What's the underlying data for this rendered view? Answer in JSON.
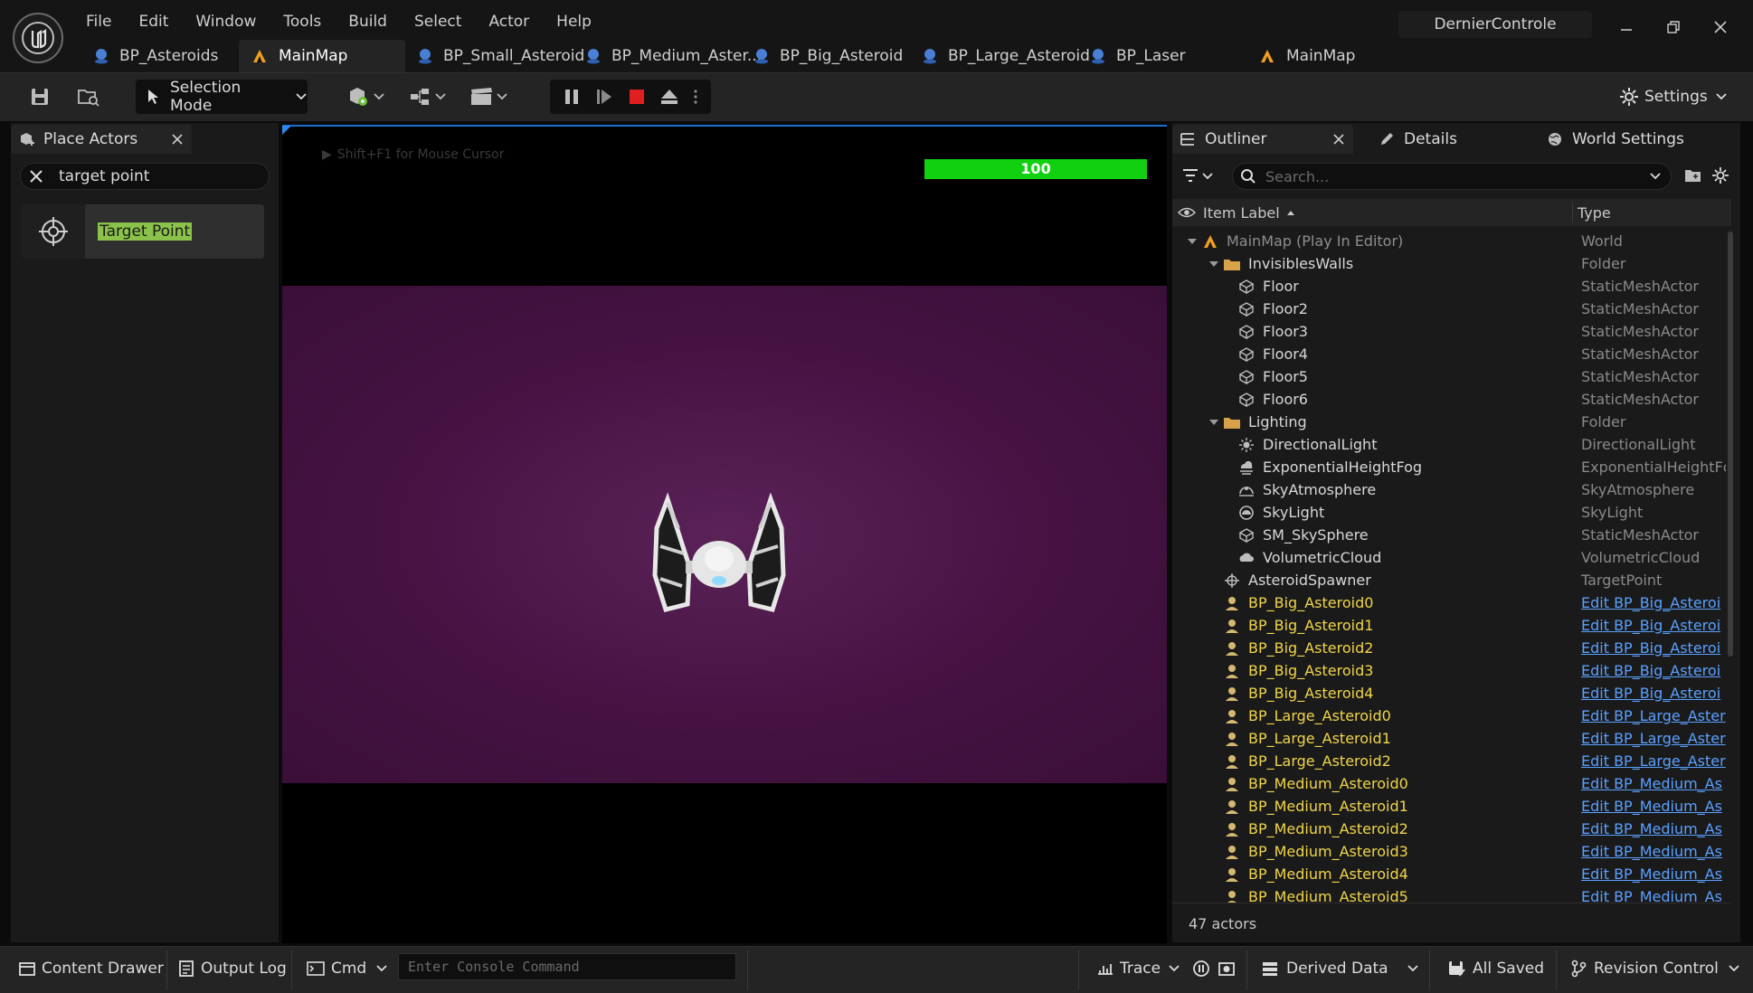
{
  "menu": [
    "File",
    "Edit",
    "Window",
    "Tools",
    "Build",
    "Select",
    "Actor",
    "Help"
  ],
  "project_name": "DernierControle",
  "doc_tabs": [
    {
      "label": "BP_Asteroids",
      "icon": "blueprint-icon"
    },
    {
      "label": "MainMap",
      "icon": "map-icon",
      "active": true
    },
    {
      "label": "BP_Small_Asteroid",
      "icon": "blueprint-icon"
    },
    {
      "label": "BP_Medium_Aster...",
      "icon": "blueprint-icon"
    },
    {
      "label": "BP_Big_Asteroid",
      "icon": "blueprint-icon"
    },
    {
      "label": "BP_Large_Asteroid",
      "icon": "blueprint-icon"
    },
    {
      "label": "BP_Laser",
      "icon": "blueprint-icon"
    },
    {
      "label": "MainMap",
      "icon": "map-icon"
    }
  ],
  "toolbar": {
    "selection_mode": "Selection Mode",
    "settings": "Settings"
  },
  "place_actors": {
    "tab_label": "Place Actors",
    "search_value": "target point",
    "result_label": "Target Point"
  },
  "viewport": {
    "hint": "Shift+F1 for Mouse Cursor",
    "health_value": "100"
  },
  "outliner": {
    "tab_outliner": "Outliner",
    "tab_details": "Details",
    "tab_world_settings": "World Settings",
    "search_placeholder": "Search...",
    "col_label": "Item Label",
    "col_type": "Type",
    "actor_count": "47 actors",
    "rows": [
      {
        "label": "MainMap (Play In Editor)",
        "type": "World",
        "indent": 0,
        "kind": "world",
        "icon": "map-icon"
      },
      {
        "label": "InvisiblesWalls",
        "type": "Folder",
        "indent": 1,
        "kind": "folder",
        "icon": "folder-icon"
      },
      {
        "label": "Floor",
        "type": "StaticMeshActor",
        "indent": 2,
        "kind": "item",
        "icon": "static-mesh-icon"
      },
      {
        "label": "Floor2",
        "type": "StaticMeshActor",
        "indent": 2,
        "kind": "item",
        "icon": "static-mesh-icon"
      },
      {
        "label": "Floor3",
        "type": "StaticMeshActor",
        "indent": 2,
        "kind": "item",
        "icon": "static-mesh-icon"
      },
      {
        "label": "Floor4",
        "type": "StaticMeshActor",
        "indent": 2,
        "kind": "item",
        "icon": "static-mesh-icon"
      },
      {
        "label": "Floor5",
        "type": "StaticMeshActor",
        "indent": 2,
        "kind": "item",
        "icon": "static-mesh-icon"
      },
      {
        "label": "Floor6",
        "type": "StaticMeshActor",
        "indent": 2,
        "kind": "item",
        "icon": "static-mesh-icon"
      },
      {
        "label": "Lighting",
        "type": "Folder",
        "indent": 1,
        "kind": "folder",
        "icon": "folder-icon"
      },
      {
        "label": "DirectionalLight",
        "type": "DirectionalLight",
        "indent": 2,
        "kind": "item",
        "icon": "sun-icon"
      },
      {
        "label": "ExponentialHeightFog",
        "type": "ExponentialHeightFc",
        "indent": 2,
        "kind": "item",
        "icon": "fog-icon"
      },
      {
        "label": "SkyAtmosphere",
        "type": "SkyAtmosphere",
        "indent": 2,
        "kind": "item",
        "icon": "sky-icon"
      },
      {
        "label": "SkyLight",
        "type": "SkyLight",
        "indent": 2,
        "kind": "item",
        "icon": "skylight-icon"
      },
      {
        "label": "SM_SkySphere",
        "type": "StaticMeshActor",
        "indent": 2,
        "kind": "item",
        "icon": "static-mesh-icon"
      },
      {
        "label": "VolumetricCloud",
        "type": "VolumetricCloud",
        "indent": 2,
        "kind": "item",
        "icon": "cloud-icon"
      },
      {
        "label": "AsteroidSpawner",
        "type": "TargetPoint",
        "indent": 1,
        "kind": "item",
        "icon": "target-point-icon"
      },
      {
        "label": "BP_Big_Asteroid0",
        "type": "Edit BP_Big_Asteroi",
        "indent": 1,
        "kind": "actor",
        "icon": "pawn-icon"
      },
      {
        "label": "BP_Big_Asteroid1",
        "type": "Edit BP_Big_Asteroi",
        "indent": 1,
        "kind": "actor",
        "icon": "pawn-icon"
      },
      {
        "label": "BP_Big_Asteroid2",
        "type": "Edit BP_Big_Asteroi",
        "indent": 1,
        "kind": "actor",
        "icon": "pawn-icon"
      },
      {
        "label": "BP_Big_Asteroid3",
        "type": "Edit BP_Big_Asteroi",
        "indent": 1,
        "kind": "actor",
        "icon": "pawn-icon"
      },
      {
        "label": "BP_Big_Asteroid4",
        "type": "Edit BP_Big_Asteroi",
        "indent": 1,
        "kind": "actor",
        "icon": "pawn-icon"
      },
      {
        "label": "BP_Large_Asteroid0",
        "type": "Edit BP_Large_Aster",
        "indent": 1,
        "kind": "actor",
        "icon": "pawn-icon"
      },
      {
        "label": "BP_Large_Asteroid1",
        "type": "Edit BP_Large_Aster",
        "indent": 1,
        "kind": "actor",
        "icon": "pawn-icon"
      },
      {
        "label": "BP_Large_Asteroid2",
        "type": "Edit BP_Large_Aster",
        "indent": 1,
        "kind": "actor",
        "icon": "pawn-icon"
      },
      {
        "label": "BP_Medium_Asteroid0",
        "type": "Edit BP_Medium_As",
        "indent": 1,
        "kind": "actor",
        "icon": "pawn-icon"
      },
      {
        "label": "BP_Medium_Asteroid1",
        "type": "Edit BP_Medium_As",
        "indent": 1,
        "kind": "actor",
        "icon": "pawn-icon"
      },
      {
        "label": "BP_Medium_Asteroid2",
        "type": "Edit BP_Medium_As",
        "indent": 1,
        "kind": "actor",
        "icon": "pawn-icon"
      },
      {
        "label": "BP_Medium_Asteroid3",
        "type": "Edit BP_Medium_As",
        "indent": 1,
        "kind": "actor",
        "icon": "pawn-icon"
      },
      {
        "label": "BP_Medium_Asteroid4",
        "type": "Edit BP_Medium_As",
        "indent": 1,
        "kind": "actor",
        "icon": "pawn-icon"
      },
      {
        "label": "BP_Medium_Asteroid5",
        "type": "Edit BP_Medium_As",
        "indent": 1,
        "kind": "actor",
        "icon": "pawn-icon"
      }
    ]
  },
  "bottom": {
    "content_drawer": "Content Drawer",
    "output_log": "Output Log",
    "cmd": "Cmd",
    "console_placeholder": "Enter Console Command",
    "trace": "Trace",
    "derived_data": "Derived Data",
    "all_saved": "All Saved",
    "revision_control": "Revision Control"
  },
  "colors": {
    "health_bar": "#10d010",
    "viewport_purple": "#451242",
    "actor_label": "#f0d54a",
    "link": "#5aa0ff",
    "stop_button": "#e02020",
    "highlight": "#8bc34a"
  }
}
